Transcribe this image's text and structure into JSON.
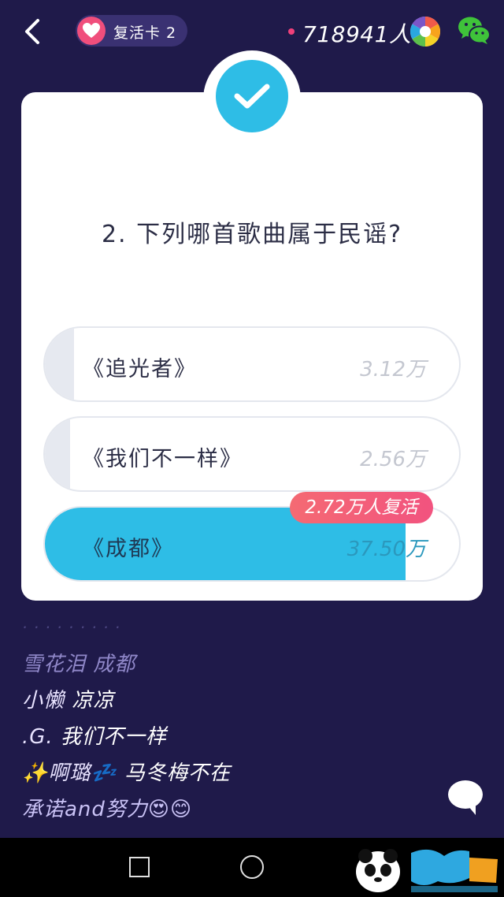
{
  "header": {
    "revive_card_label": "复活卡 2",
    "online_count": "718941人"
  },
  "quiz": {
    "question": "2. 下列哪首歌曲属于民谣?",
    "options": [
      {
        "label": "《追光者》",
        "count": "3.12万",
        "share": 0.07,
        "selected": false
      },
      {
        "label": "《我们不一样》",
        "count": "2.56万",
        "share": 0.06,
        "selected": false
      },
      {
        "label": "《成都》",
        "count": "37.50万",
        "share": 0.87,
        "selected": true
      }
    ],
    "revive_tag": "2.72万人复活"
  },
  "chat": [
    {
      "name": "雪花泪",
      "text": "成都",
      "name_color": "#8f87c8",
      "text_color": "#8f87c8"
    },
    {
      "name": "小懒",
      "text": "凉凉",
      "name_color": "#e8e3ff",
      "text_color": "#ffffff"
    },
    {
      "name": ".G.",
      "text": "我们不一样",
      "name_color": "#e8e3ff",
      "text_color": "#ffffff"
    },
    {
      "name": "✨啊璐💤",
      "text": "马冬梅不在",
      "name_color": "#e8e3ff",
      "text_color": "#ffffff"
    },
    {
      "name": "承诺and努力😍😊",
      "text": "",
      "name_color": "#c9c2f5",
      "text_color": "#ffffff"
    }
  ],
  "colors": {
    "background": "#1f1a4a",
    "accent": "#2ebde6",
    "pink": "#f04e7c"
  },
  "icons": [
    "back-icon",
    "heart-icon",
    "camera-aperture-icon",
    "wechat-icon",
    "checkmark-icon",
    "chat-bubble-icon",
    "square-nav-icon",
    "circle-nav-icon"
  ]
}
